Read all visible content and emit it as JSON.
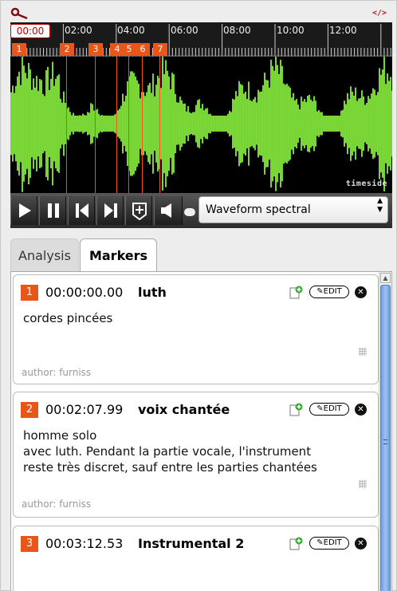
{
  "toolbar": {
    "search_icon": "search-icon",
    "embed_label": "</>"
  },
  "player": {
    "current_time": "00:00",
    "ruler_labels": [
      "02:00",
      "04:00",
      "06:00",
      "08:00",
      "10:00",
      "12:00"
    ],
    "marker_flags": [
      "1",
      "2",
      "3",
      "4",
      "5",
      "6",
      "7"
    ],
    "brand": "timeside",
    "view_select": "Waveform spectral",
    "colors": {
      "marker": "#e8561a",
      "wave_green": "#7bd42a"
    }
  },
  "tabs": {
    "analysis": "Analysis",
    "markers": "Markers"
  },
  "markers": [
    {
      "index": "1",
      "time": "00:00:00.00",
      "title": "luth",
      "description": "cordes pincées",
      "author": "author: furniss",
      "edit": "EDIT"
    },
    {
      "index": "2",
      "time": "00:02:07.99",
      "title": "voix chantée",
      "description": "homme solo\navec luth. Pendant la partie vocale, l'instrument\nreste très discret, sauf entre les parties chantées",
      "author": "author: furniss",
      "edit": "EDIT"
    },
    {
      "index": "3",
      "time": "00:03:12.53",
      "title": "Instrumental 2",
      "description": "",
      "author": "",
      "edit": "EDIT"
    }
  ]
}
